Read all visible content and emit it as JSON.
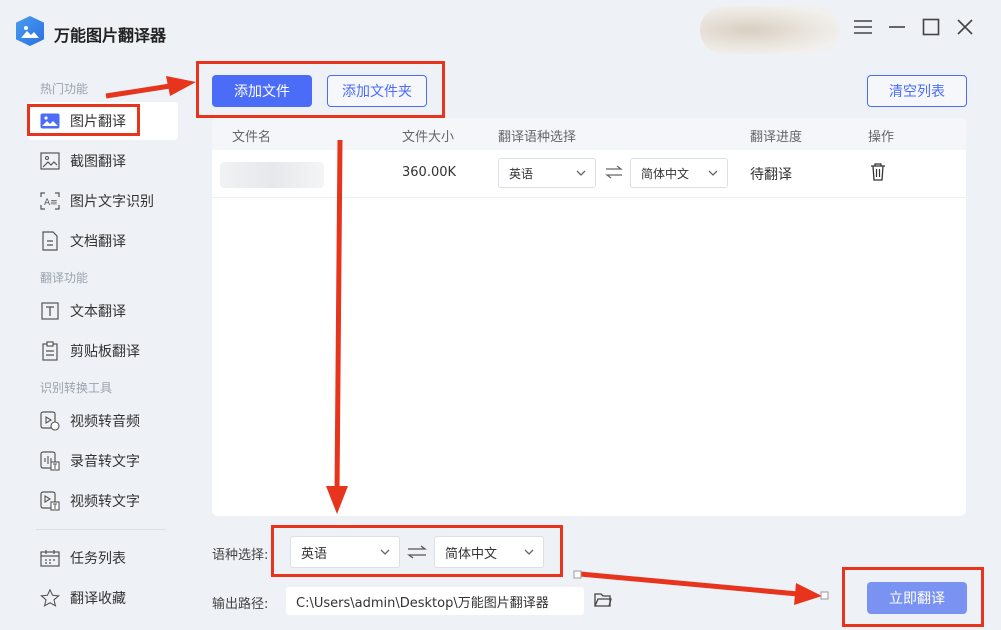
{
  "app": {
    "title": "万能图片翻译器"
  },
  "window_controls": [
    "menu-icon",
    "minimize-icon",
    "maximize-icon",
    "close-icon"
  ],
  "sidebar": {
    "sections": [
      {
        "label": "热门功能"
      },
      {
        "label": "翻译功能"
      },
      {
        "label": "识别转换工具"
      }
    ],
    "items": [
      {
        "label": "图片翻译",
        "icon": "image-icon"
      },
      {
        "label": "截图翻译",
        "icon": "screenshot-icon"
      },
      {
        "label": "图片文字识别",
        "icon": "ocr-icon"
      },
      {
        "label": "文档翻译",
        "icon": "document-icon"
      },
      {
        "label": "文本翻译",
        "icon": "text-icon"
      },
      {
        "label": "剪贴板翻译",
        "icon": "clipboard-icon"
      },
      {
        "label": "视频转音频",
        "icon": "video-audio-icon"
      },
      {
        "label": "录音转文字",
        "icon": "audio-text-icon"
      },
      {
        "label": "视频转文字",
        "icon": "video-text-icon"
      },
      {
        "label": "任务列表",
        "icon": "calendar-icon"
      },
      {
        "label": "翻译收藏",
        "icon": "star-icon"
      }
    ]
  },
  "toolbar": {
    "add_file": "添加文件",
    "add_folder": "添加文件夹",
    "clear_list": "清空列表"
  },
  "table": {
    "headers": [
      "文件名",
      "文件大小",
      "翻译语种选择",
      "翻译进度",
      "操作"
    ],
    "rows": [
      {
        "name": "",
        "size": "360.00K",
        "source_lang": "英语",
        "target_lang": "简体中文",
        "status": "待翻译"
      }
    ]
  },
  "bottom": {
    "lang_label": "语种选择:",
    "source_lang": "英语",
    "target_lang": "简体中文",
    "path_label": "输出路径:",
    "path_value": "C:\\Users\\admin\\Desktop\\万能图片翻译器",
    "translate_button": "立即翻译"
  },
  "colors": {
    "accent": "#4a6cf7",
    "annotation": "#e8341c",
    "background": "#eef1f5"
  }
}
